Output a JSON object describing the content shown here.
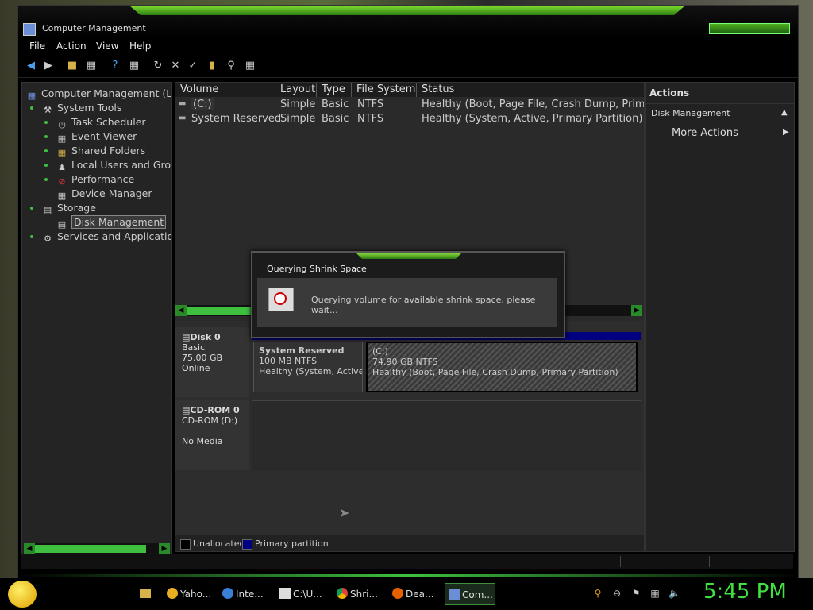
{
  "window": {
    "title": "Computer Management"
  },
  "menu": [
    "File",
    "Action",
    "View",
    "Help"
  ],
  "tree": {
    "root": "Computer Management (Loc",
    "system_tools": "System Tools",
    "task_scheduler": "Task Scheduler",
    "event_viewer": "Event Viewer",
    "shared_folders": "Shared Folders",
    "local_users": "Local Users and Grou",
    "performance": "Performance",
    "device_manager": "Device Manager",
    "storage": "Storage",
    "disk_management": "Disk Management",
    "services": "Services and Application"
  },
  "volumes": {
    "headers": [
      "Volume",
      "Layout",
      "Type",
      "File System",
      "Status"
    ],
    "rows": [
      {
        "volume": "(C:)",
        "layout": "Simple",
        "type": "Basic",
        "fs": "NTFS",
        "status": "Healthy (Boot, Page File, Crash Dump, Primary"
      },
      {
        "volume": "System Reserved",
        "layout": "Simple",
        "type": "Basic",
        "fs": "NTFS",
        "status": "Healthy (System, Active, Primary Partition)"
      }
    ]
  },
  "disks": {
    "disk0": {
      "name": "Disk 0",
      "type": "Basic",
      "size": "75.00 GB",
      "state": "Online"
    },
    "part_reserved": {
      "name": "System Reserved",
      "size": "100 MB NTFS",
      "status": "Healthy (System, Active, P"
    },
    "part_c": {
      "name": "(C:)",
      "size": "74.90 GB NTFS",
      "status": "Healthy (Boot, Page File, Crash Dump, Primary Partition)"
    },
    "cdrom": {
      "name": "CD-ROM 0",
      "type": "CD-ROM (D:)",
      "state": "No Media"
    }
  },
  "legend": {
    "unallocated": "Unallocated",
    "primary": "Primary partition"
  },
  "actions": {
    "header": "Actions",
    "section": "Disk Management",
    "more": "More Actions"
  },
  "dialog": {
    "title": "Querying Shrink Space",
    "message": "Querying volume for available shrink space, please wait..."
  },
  "taskbar": {
    "tasks": [
      "Yaho...",
      "Inte...",
      "C:\\U...",
      "Shri...",
      "Dea...",
      "Com..."
    ],
    "clock": "5:45 PM"
  },
  "colors": {
    "accent": "#3fbf3f",
    "primary_partition": "#000080"
  }
}
